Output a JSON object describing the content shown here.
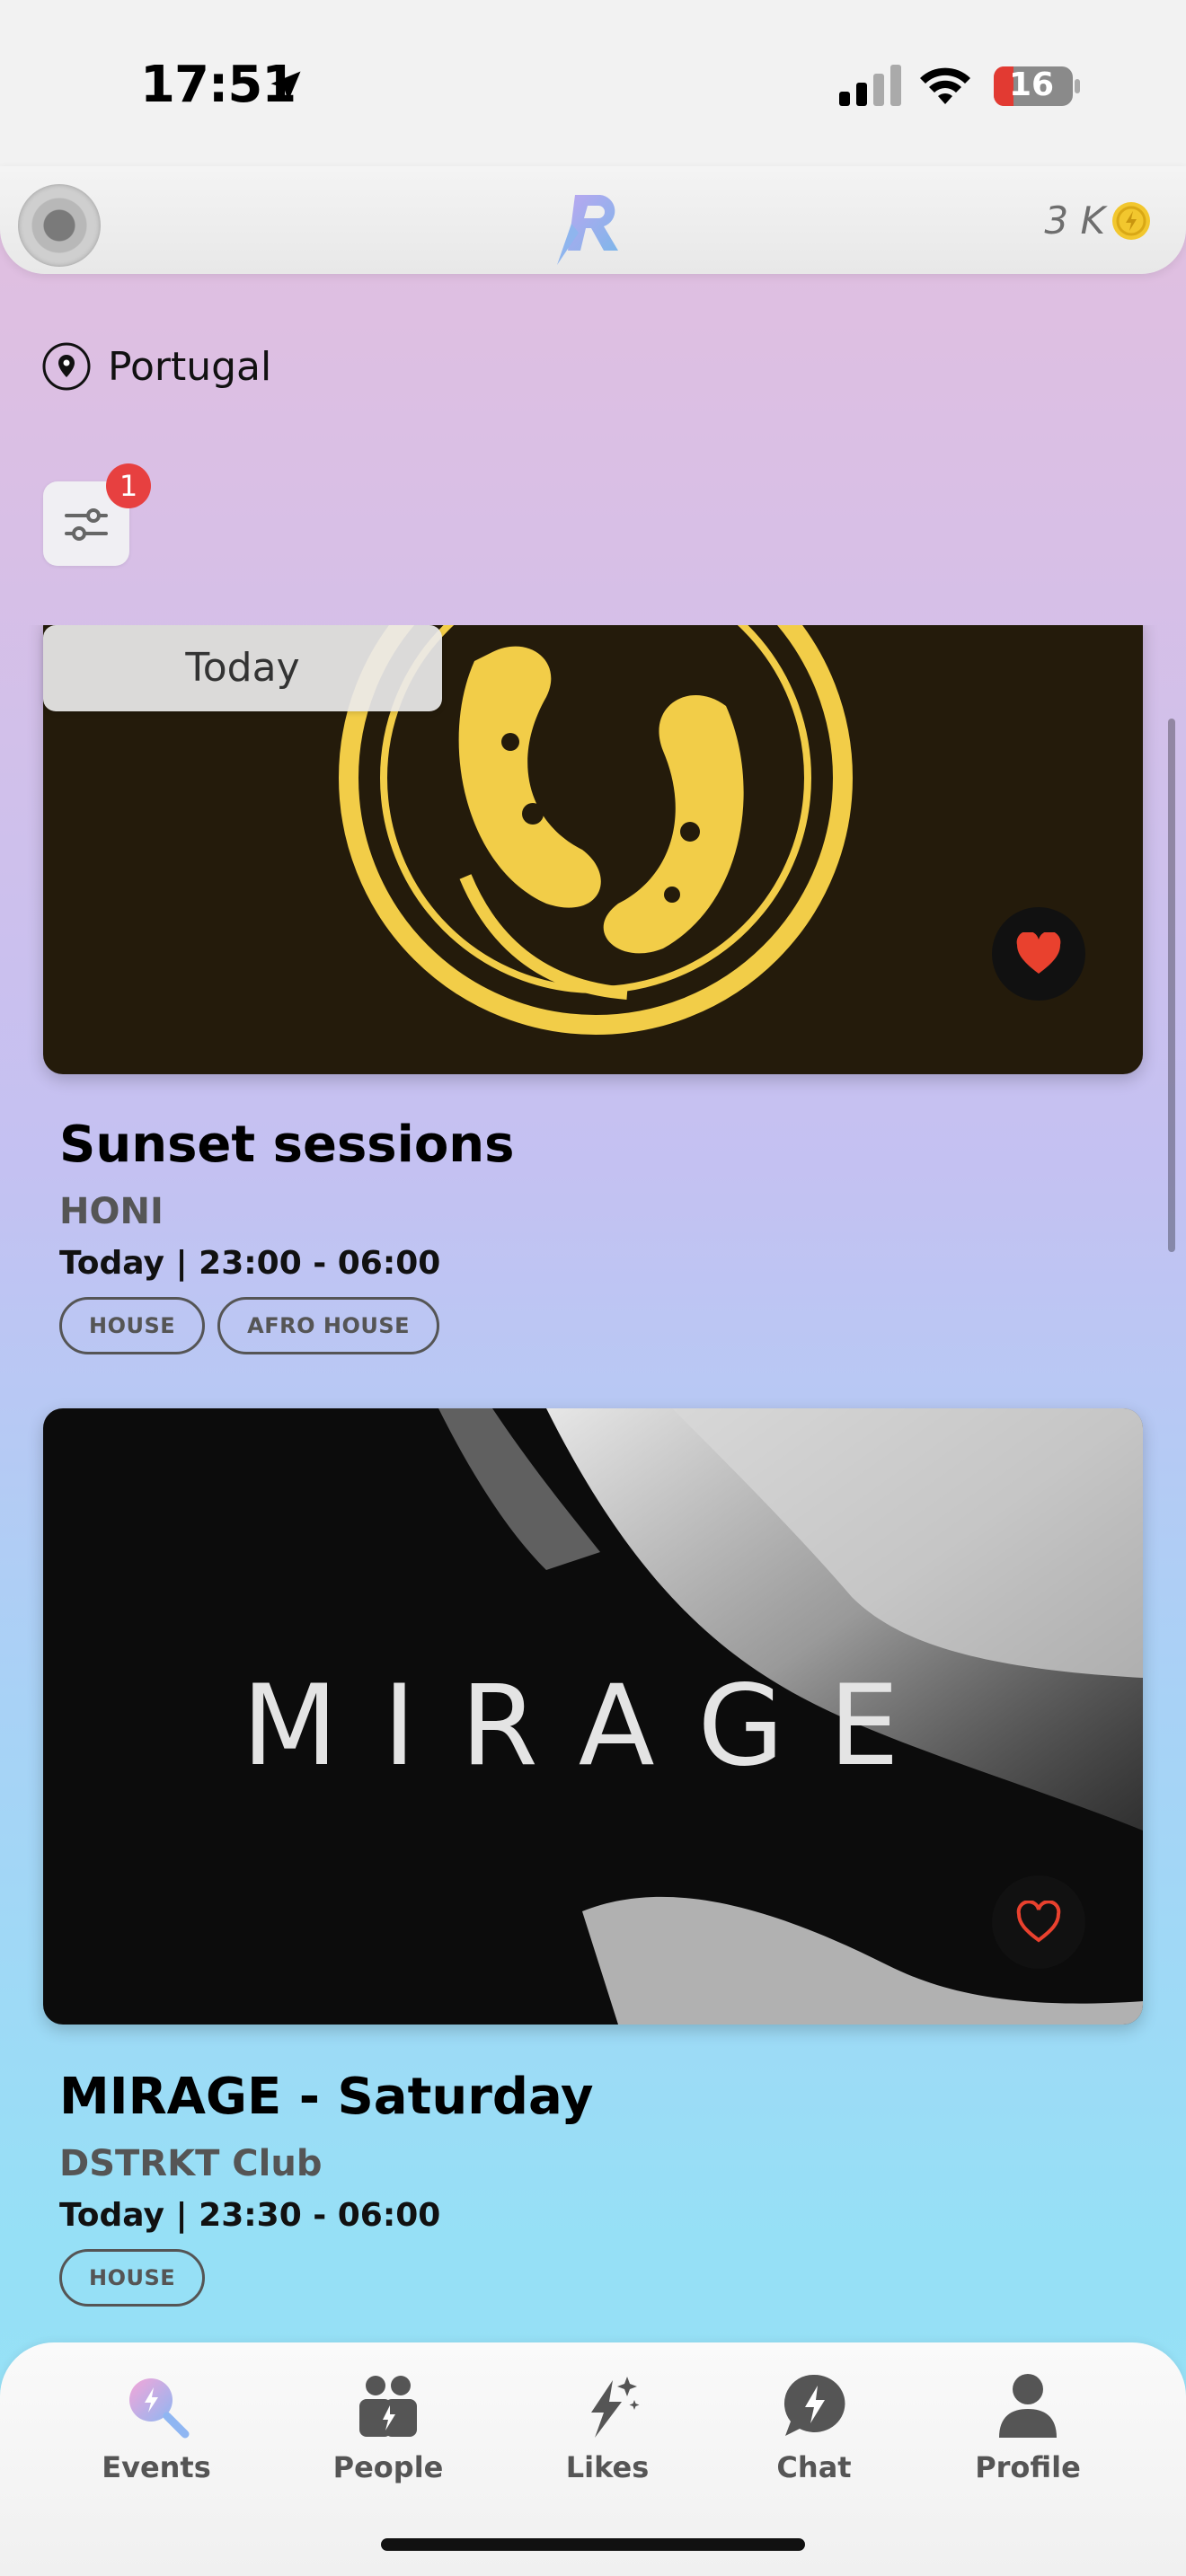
{
  "status_bar": {
    "time": "17:51",
    "battery": "16"
  },
  "header": {
    "coins": "3 K"
  },
  "location": {
    "label": "Portugal"
  },
  "filter": {
    "badge_count": "1"
  },
  "date_chip": {
    "label": "Today"
  },
  "events": [
    {
      "title": "Sunset sessions",
      "venue": "HONI",
      "time": "Today | 23:00 - 06:00",
      "tags": [
        "HOUSE",
        "AFRO HOUSE"
      ],
      "favorited": true
    },
    {
      "title": "MIRAGE - Saturday",
      "venue": "DSTRKT Club",
      "time": "Today | 23:30 - 06:00",
      "tags": [
        "HOUSE"
      ],
      "favorited": false,
      "poster_text": "MIRAGE"
    }
  ],
  "tabbar": {
    "items": [
      {
        "label": "Events",
        "icon": "events-search-icon",
        "active": true
      },
      {
        "label": "People",
        "icon": "people-icon"
      },
      {
        "label": "Likes",
        "icon": "likes-sparkle-icon"
      },
      {
        "label": "Chat",
        "icon": "chat-bubble-icon"
      },
      {
        "label": "Profile",
        "icon": "profile-icon"
      }
    ]
  },
  "colors": {
    "accent_red": "#e74040",
    "heart_red": "#e9412e",
    "poster_yellow": "#f2cd48"
  }
}
